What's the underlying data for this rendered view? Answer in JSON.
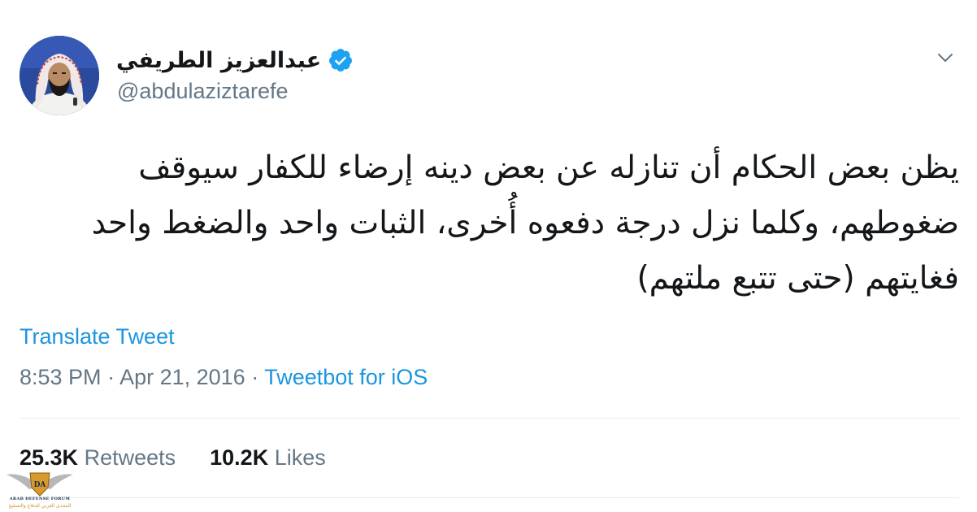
{
  "author": {
    "display_name": "عبدالعزيز الطريفي",
    "handle": "@abdulaziztarefe",
    "verified": true,
    "verified_color": "#1da1f2"
  },
  "tweet": {
    "lines": [
      "يظن بعض الحكام أن تنازله عن بعض دينه إرضاء للكفار سيوقف",
      "ضغوطهم، وكلما نزل درجة دفعوه أُخرى، الثبات واحد والضغط واحد",
      "فغايتهم (حتى تتبع ملتهم)"
    ]
  },
  "translate_label": "Translate Tweet",
  "meta": {
    "time": "8:53 PM",
    "separator": " · ",
    "date": "Apr 21, 2016",
    "source": "Tweetbot for iOS"
  },
  "stats": {
    "retweets_count": "25.3K",
    "retweets_label": "Retweets",
    "likes_count": "10.2K",
    "likes_label": "Likes"
  },
  "watermark": {
    "title": "ARAB DEFENSE FORUM",
    "subtitle": "المنتدى العربي للدفاع والتسليح"
  },
  "colors": {
    "link": "#1b95e0",
    "secondary_text": "#657786",
    "primary_text": "#14171a",
    "divider": "#e6ecf0"
  }
}
